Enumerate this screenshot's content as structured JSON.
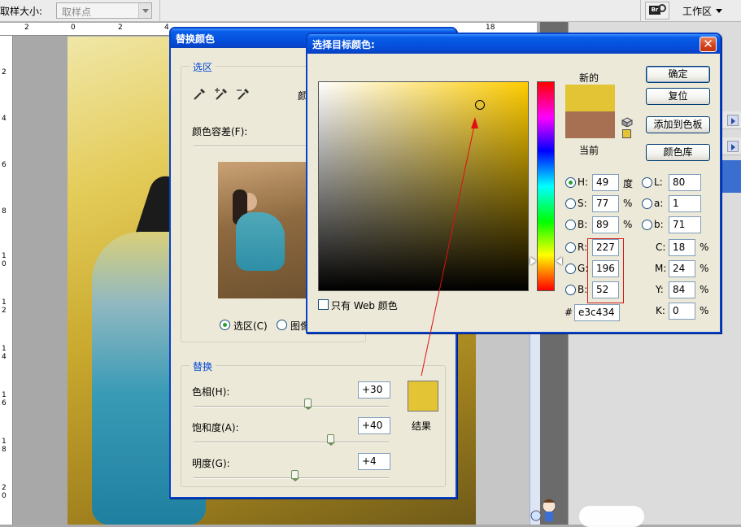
{
  "options_bar": {
    "sample_size_label": "取样大小:",
    "sample_size_value": "取样点",
    "workspace_label": "工作区",
    "bridge_icon_text": "Br"
  },
  "ruler": {
    "top_numbers": [
      "2",
      "0",
      "2",
      "4",
      "18"
    ],
    "left_numbers": [
      "2",
      "4",
      "6",
      "8",
      "1\n0",
      "1\n2",
      "1\n4",
      "1\n6",
      "1\n8",
      "2\n0"
    ]
  },
  "replace_dialog": {
    "title": "替换颜色",
    "selection_group": "选区",
    "color_label_partial": "颜",
    "fuzziness_label": "颜色容差(F):",
    "radio_selection": "选区(C)",
    "radio_image": "图像",
    "replace_group": "替换",
    "hue_label": "色相(H):",
    "hue_value": "+30",
    "saturation_label": "饱和度(A):",
    "saturation_value": "+40",
    "lightness_label": "明度(G):",
    "lightness_value": "+4",
    "result_label": "结果",
    "result_color": "#e3c434"
  },
  "picker_dialog": {
    "title": "选择目标颜色:",
    "new_label": "新的",
    "current_label": "当前",
    "new_color": "#e3c434",
    "current_color": "#a87052",
    "ok_button": "确定",
    "reset_button": "复位",
    "add_swatch_button": "添加到色板",
    "color_library_button": "颜色库",
    "web_only_label": "只有 Web 颜色",
    "h_label": "H:",
    "h_value": "49",
    "h_unit": "度",
    "s_label": "S:",
    "s_value": "77",
    "s_unit": "%",
    "b_label": "B:",
    "b_value": "89",
    "b_unit": "%",
    "r_label": "R:",
    "r_value": "227",
    "g_label": "G:",
    "g_value": "196",
    "bl_label": "B:",
    "bl_value": "52",
    "l_label": "L:",
    "l_value": "80",
    "a_label": "a:",
    "a_value": "1",
    "b2_label": "b:",
    "b2_value": "71",
    "c_label": "C:",
    "c_value": "18",
    "m_label": "M:",
    "m_value": "24",
    "y_label": "Y:",
    "y_value": "84",
    "k_label": "K:",
    "k_value": "0",
    "pct": "%",
    "hex_label": "#",
    "hex_value": "e3c434",
    "close_glyph": "✕"
  }
}
